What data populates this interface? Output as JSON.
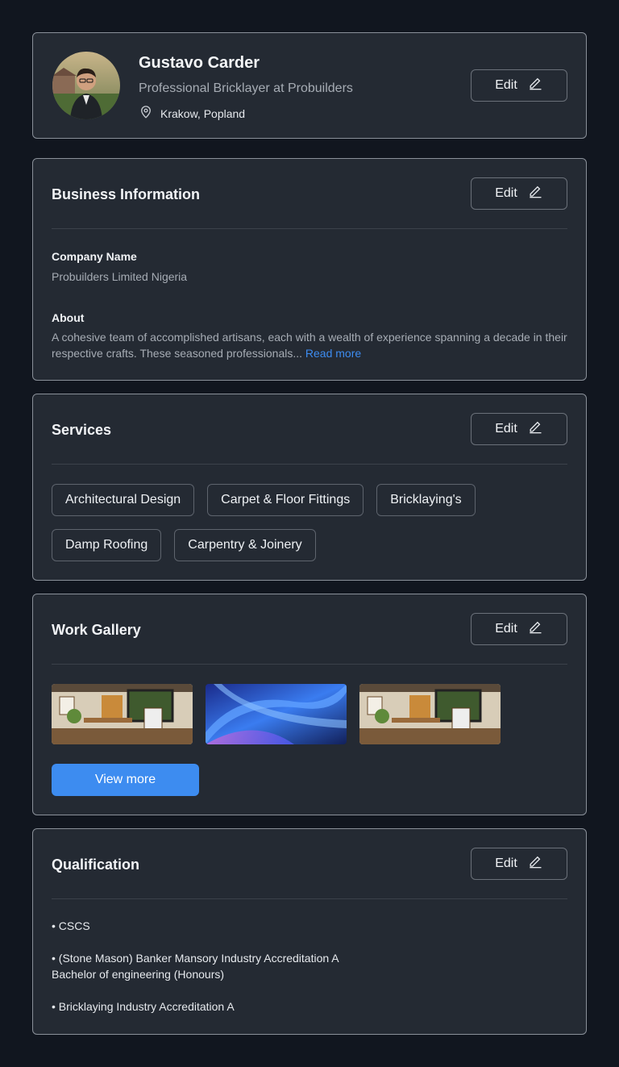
{
  "profile": {
    "name": "Gustavo Carder",
    "title": "Professional Bricklayer at Probuilders",
    "location": "Krakow, Popland",
    "edit_label": "Edit"
  },
  "business": {
    "heading": "Business Information",
    "edit_label": "Edit",
    "company_label": "Company Name",
    "company_value": "Probuilders Limited Nigeria",
    "about_label": "About",
    "about_text": "A cohesive team of accomplished artisans, each with a wealth of experience spanning a decade in their respective crafts. These seasoned professionals...",
    "read_more": "Read more"
  },
  "services": {
    "heading": "Services",
    "edit_label": "Edit",
    "items": [
      "Architectural Design",
      "Carpet & Floor Fittings",
      "Bricklaying's",
      "Damp Roofing",
      "Carpentry & Joinery"
    ]
  },
  "gallery": {
    "heading": "Work Gallery",
    "edit_label": "Edit",
    "view_more": "View more"
  },
  "qualification": {
    "heading": "Qualification",
    "edit_label": "Edit",
    "items": [
      "• CSCS",
      "• (Stone Mason) Banker Mansory Industry Accreditation A\nBachelor of engineering (Honours)",
      "• Bricklaying Industry Accreditation A"
    ]
  },
  "colors": {
    "background": "#11161f",
    "card": "#242a33",
    "accent": "#3d8cf0",
    "muted_text": "#a6acb4"
  },
  "icons": [
    "location-pin-icon",
    "pencil-icon"
  ]
}
